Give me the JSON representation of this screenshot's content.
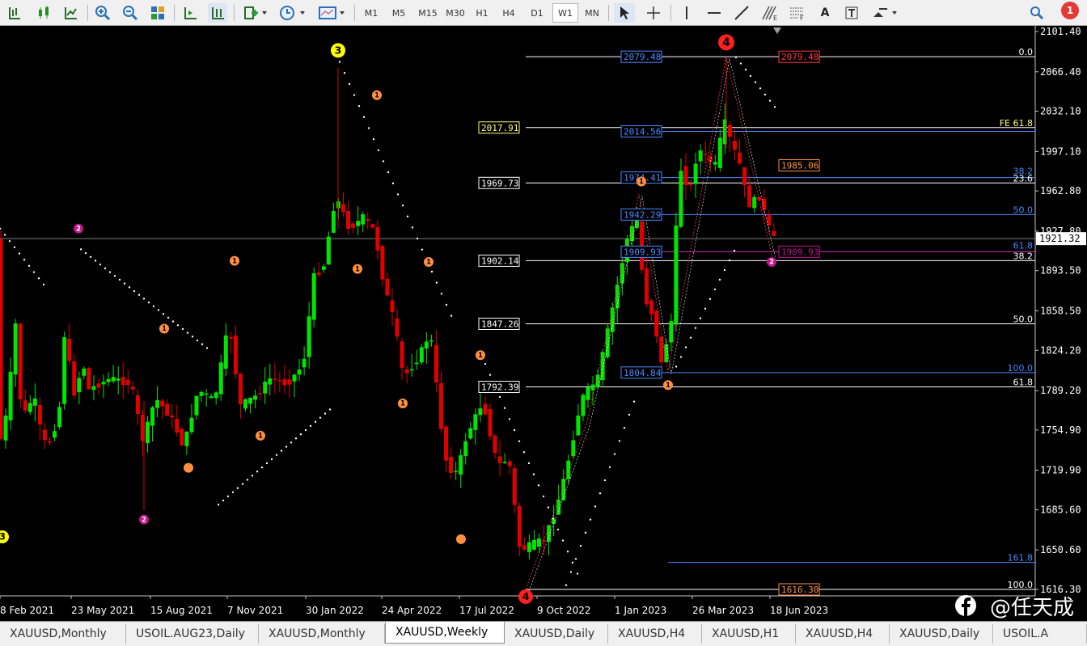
{
  "toolbar": {
    "icons": [
      "bar-chart",
      "candlestick-chart",
      "line-chart",
      "zoom-in",
      "zoom-out",
      "tile-windows",
      "chart-shift",
      "auto-scroll",
      "indicators",
      "periods",
      "templates",
      "cursor",
      "crosshair",
      "vertical-line",
      "horizontal-line",
      "trendline",
      "fibonacci-expansion",
      "fibonacci-fan",
      "text-label",
      "text-box",
      "arrows",
      "search",
      "notifications"
    ],
    "timeframes": [
      "M1",
      "M5",
      "M15",
      "M30",
      "H1",
      "H4",
      "D1",
      "W1",
      "MN"
    ],
    "active_timeframe": "W1",
    "notification_count": "1"
  },
  "chart": {
    "symbol": "XAUUSD,Weekly",
    "price_axis": [
      "2101.40",
      "2066.40",
      "2032.10",
      "1997.10",
      "1962.80",
      "1927.80",
      "1893.50",
      "1858.50",
      "1824.20",
      "1789.20",
      "1754.90",
      "1719.90",
      "1685.60",
      "1650.60",
      "1616.30"
    ],
    "current_price": "1921.32",
    "time_axis": [
      "8 Feb 2021",
      "23 May 2021",
      "15 Aug 2021",
      "7 Nov 2021",
      "30 Jan 2022",
      "24 Apr 2022",
      "17 Jul 2022",
      "9 Oct 2022",
      "1 Jan 2023",
      "26 Mar 2023",
      "18 Jun 2023"
    ],
    "fib_left_labels": [
      "2017.91",
      "1969.73",
      "1902.14",
      "1847.26",
      "1792.39"
    ],
    "fib_left_levels": [
      "FE 61.8",
      "23.6",
      "38.2",
      "50.0",
      "61.8"
    ],
    "fib_blue_labels": [
      "2079.48",
      "2014.56",
      "1974.41",
      "1942.29",
      "1909.93",
      "1804.84"
    ],
    "fib_blue_levels": [
      "0.0",
      "38.2",
      "23.6",
      "50.0",
      "61.8",
      "100.0",
      "161.8",
      "100.0"
    ],
    "red_labels": [
      "2079.48",
      "1985.06",
      "1909.93",
      "1616.30"
    ],
    "wave_marks": [
      "3",
      "3",
      "4",
      "4",
      "1",
      "1",
      "1",
      "1",
      "1",
      "1",
      "1",
      "1",
      "2",
      "2",
      "2",
      "1",
      "1"
    ],
    "watermark": "@任天成",
    "colors": {
      "bull": "#00e600",
      "bear": "#e00000",
      "bg": "#000000",
      "fib_white": "#ffffff",
      "fib_blue": "#4a88ff",
      "fib_yellow": "#ffff80",
      "red_label": "#ff3a3a",
      "orange": "#ff9040",
      "wave_purple": "#c2178a"
    }
  },
  "tabs": [
    "XAUUSD,Monthly",
    "USOIL.AUG23,Daily",
    "XAUUSD,Monthly",
    "XAUUSD,Weekly",
    "XAUUSD,Daily",
    "XAUUSD,H4",
    "XAUUSD,H1",
    "XAUUSD,H4",
    "XAUUSD,Daily",
    "USOIL.A"
  ],
  "active_tab": "XAUUSD,Weekly"
}
